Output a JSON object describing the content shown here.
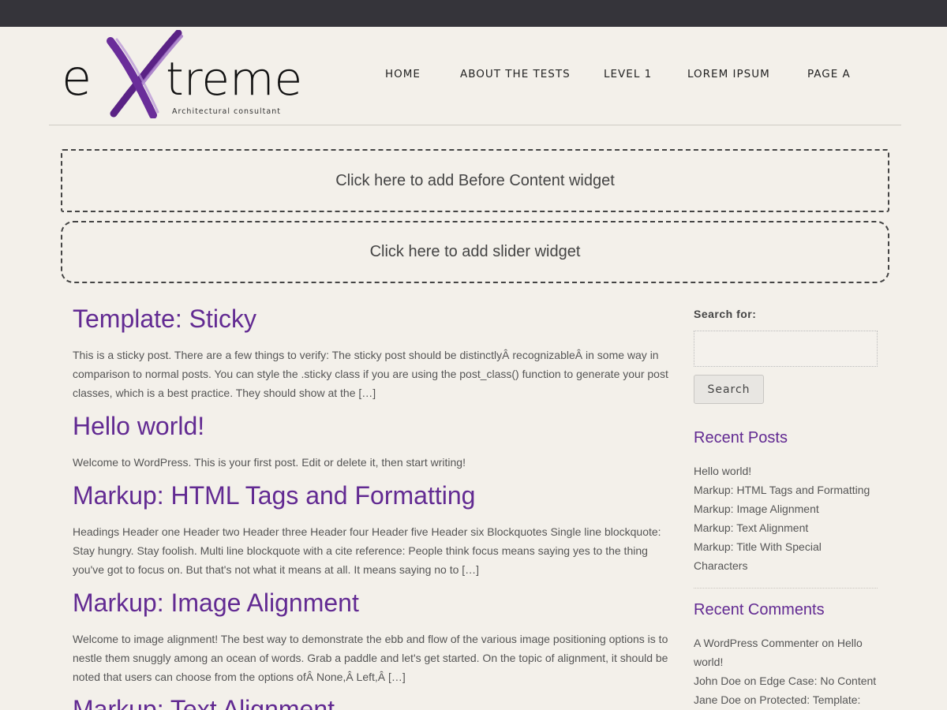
{
  "header": {
    "logo": {
      "wordmark_prefix": "e",
      "wordmark_suffix": "treme",
      "tagline": "Architectural consultant",
      "accent_color": "#6a2d9a"
    },
    "nav": [
      {
        "label": "HOME"
      },
      {
        "label": "ABOUT THE TESTS"
      },
      {
        "label": "LEVEL 1"
      },
      {
        "label": "LOREM IPSUM"
      },
      {
        "label": "PAGE A"
      }
    ]
  },
  "widgets": {
    "before_content": "Click here to add Before Content widget",
    "slider": "Click here to add slider widget"
  },
  "posts": [
    {
      "title": "Template: Sticky",
      "excerpt": "This is a sticky post. There are a few things to verify: The sticky post should be distinctlyÂ recognizableÂ in some way in comparison to normal posts. You can style the .sticky class if you are using the post_class() function to generate your post classes, which is a best practice. They should show at the […]"
    },
    {
      "title": "Hello world!",
      "excerpt": "Welcome to WordPress. This is your first post. Edit or delete it, then start writing!"
    },
    {
      "title": "Markup: HTML Tags and Formatting",
      "excerpt": "Headings Header one Header two Header three Header four Header five Header six Blockquotes Single line blockquote: Stay hungry. Stay foolish. Multi line blockquote with a cite reference: People think focus means saying yes to the thing you've got to focus on. But that's not what it means at all. It means saying no to […]"
    },
    {
      "title": "Markup: Image Alignment",
      "excerpt": "Welcome to image alignment! The best way to demonstrate the ebb and flow of the various image positioning options is to nestle them snuggly among an ocean of words. Grab a paddle and let's get started. On the topic of alignment, it should be noted that users can choose from the options ofÂ None,Â Left,Â […]"
    },
    {
      "title": "Markup: Text Alignment",
      "excerpt": ""
    }
  ],
  "sidebar": {
    "search": {
      "label": "Search for:",
      "value": "",
      "button": "Search"
    },
    "recent_posts": {
      "title": "Recent Posts",
      "items": [
        "Hello world!",
        "Markup: HTML Tags and Formatting",
        "Markup: Image Alignment",
        "Markup: Text Alignment",
        "Markup: Title With Special Characters"
      ]
    },
    "recent_comments": {
      "title": "Recent Comments",
      "items": [
        {
          "author": "A WordPress Commenter",
          "on": "on",
          "post": "Hello world!"
        },
        {
          "author": "John Doe",
          "on": "on",
          "post": "Edge Case: No Content"
        },
        {
          "author": "Jane Doe",
          "on": "on",
          "post": "Protected: Template:"
        }
      ]
    }
  }
}
